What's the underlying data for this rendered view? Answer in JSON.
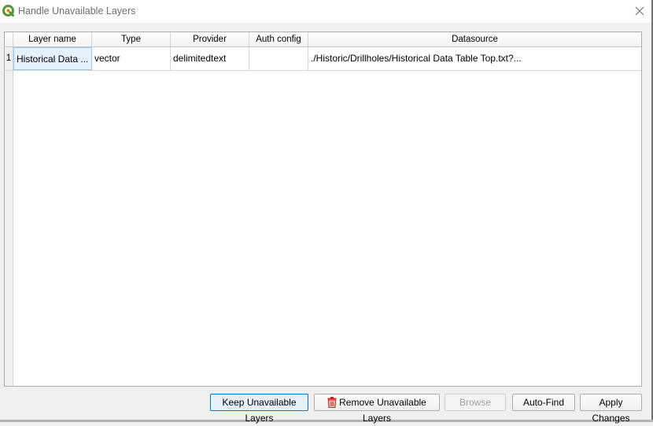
{
  "window": {
    "title": "Handle Unavailable Layers",
    "app_icon": "qgis-logo-icon",
    "close_icon": "close-icon"
  },
  "table": {
    "columns": [
      "Layer name",
      "Type",
      "Provider",
      "Auth config",
      "Datasource"
    ],
    "rows": [
      {
        "index": "1",
        "layer_name": "Historical Data ...",
        "type": "vector",
        "provider": "delimitedtext",
        "auth_config": "",
        "datasource": "./Historic/Drillholes/Historical Data Table Top.txt?..."
      }
    ]
  },
  "buttons": {
    "keep": "Keep Unavailable Layers",
    "remove": "Remove Unavailable Layers",
    "remove_icon": "trash-icon",
    "browse": "Browse",
    "auto_find": "Auto-Find",
    "apply": "Apply Changes"
  },
  "colors": {
    "accent": "#0078d7",
    "selection": "#e5f1fb",
    "trash": "#d81e1e",
    "qgis_green": "#589632"
  }
}
